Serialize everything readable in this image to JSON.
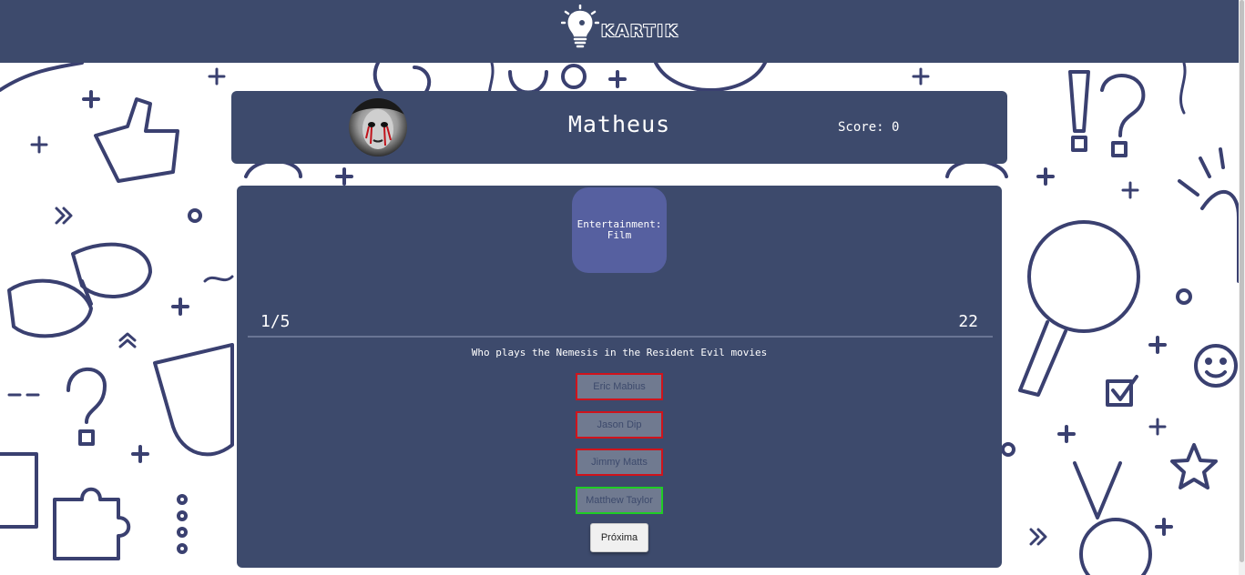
{
  "brand": {
    "name": "KARTIK",
    "logo_icon": "lightbulb-head-icon"
  },
  "player": {
    "name": "Matheus",
    "score_text": "Score: 0",
    "avatar": "avatar-image"
  },
  "quiz": {
    "category": "Entertainment: Film",
    "progress": "1/5",
    "timer": "22",
    "question": "Who plays the Nemesis in the Resident Evil movies",
    "answers": [
      {
        "label": "Eric Mabius",
        "state": "wrong"
      },
      {
        "label": "Jason Dip",
        "state": "wrong"
      },
      {
        "label": "Jimmy Matts",
        "state": "wrong"
      },
      {
        "label": "Matthew Taylor",
        "state": "correct"
      }
    ],
    "next_label": "Próxima"
  },
  "colors": {
    "panel": "#3d4a6c",
    "category_bg": "#5660a0",
    "wrong_border": "#d0131b",
    "correct_border": "#1fcd25",
    "pattern_stroke": "#3a4070"
  }
}
